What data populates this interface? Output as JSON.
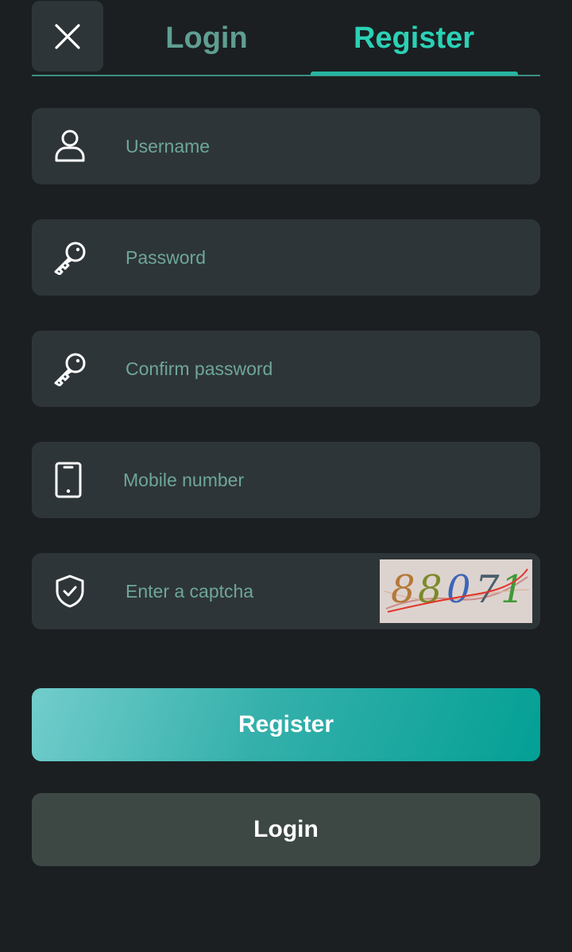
{
  "header": {
    "close_icon": "close-icon",
    "tabs": [
      {
        "label": "Login",
        "active": false
      },
      {
        "label": "Register",
        "active": true
      }
    ]
  },
  "form": {
    "username": {
      "placeholder": "Username",
      "value": "",
      "icon": "user-icon"
    },
    "password": {
      "placeholder": "Password",
      "value": "",
      "icon": "key-icon"
    },
    "confirm_password": {
      "placeholder": "Confirm password",
      "value": "",
      "icon": "key-icon"
    },
    "mobile": {
      "placeholder": "Mobile number",
      "value": "",
      "icon": "phone-icon"
    },
    "captcha": {
      "placeholder": "Enter a captcha",
      "value": "",
      "icon": "shield-check-icon",
      "image_text": "88071"
    }
  },
  "actions": {
    "register_label": "Register",
    "login_label": "Login"
  },
  "colors": {
    "background": "#1b1f21",
    "field_background": "#2e3538",
    "accent": "#2ad1b6",
    "tab_inactive": "#5f9e93",
    "placeholder": "#6ea69b",
    "login_button": "#3d4845"
  }
}
